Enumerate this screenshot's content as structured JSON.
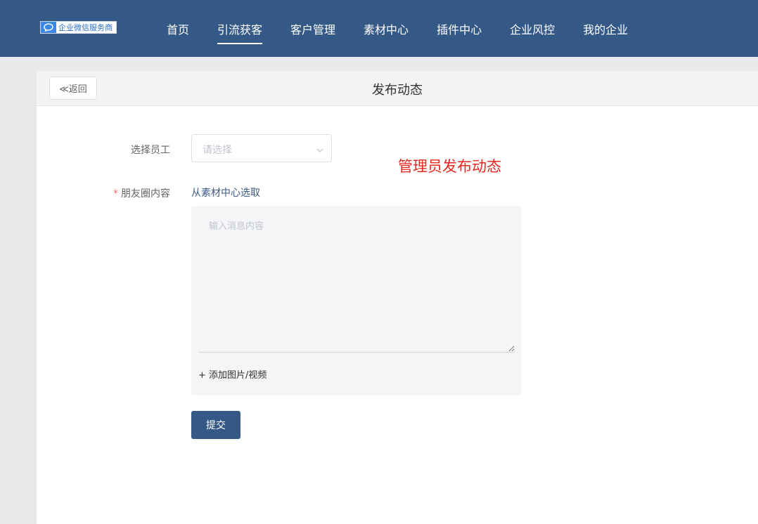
{
  "brand": {
    "logo_text": "企业微信服务商"
  },
  "nav": {
    "items": [
      "首页",
      "引流获客",
      "客户管理",
      "素材中心",
      "插件中心",
      "企业风控",
      "我的企业"
    ],
    "active_index": 1
  },
  "header": {
    "back_label": "≪返回",
    "title": "发布动态"
  },
  "form": {
    "employee_label": "选择员工",
    "employee_placeholder": "请选择",
    "required_mark": "*",
    "content_label": "朋友圈内容",
    "from_library_link": "从素材中心选取",
    "content_placeholder": "输入消息内容",
    "add_media_label": "+ 添加图片/视频",
    "submit_label": "提交"
  },
  "annotation": {
    "text": "管理员发布动态",
    "color": "#e8281e"
  },
  "colors": {
    "primary": "#355986",
    "page_bg": "#e8e9eb"
  }
}
